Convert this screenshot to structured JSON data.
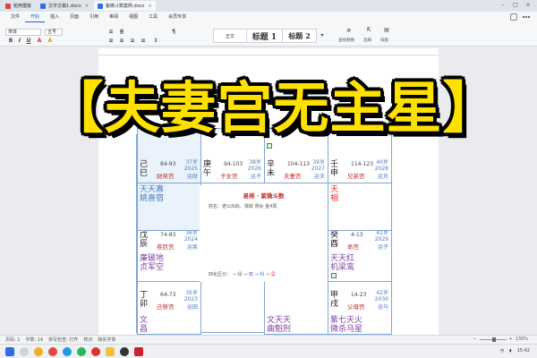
{
  "window": {
    "tabs": [
      {
        "label": "稻壳模板"
      },
      {
        "label": "文字文稿1.docx",
        "active": true
      },
      {
        "label": "紫微斗数案例.docx"
      }
    ]
  },
  "menu": {
    "items": [
      "文件",
      "开始",
      "插入",
      "页面",
      "引用",
      "审阅",
      "视图",
      "工具",
      "会员专享"
    ],
    "active_index": 1
  },
  "ribbon": {
    "font_name": "宋体",
    "font_size": "五号",
    "styles": [
      {
        "label": "正文"
      },
      {
        "label": "标题 1"
      },
      {
        "label": "标题 2"
      }
    ],
    "right_labels": [
      "查找替换",
      "选择",
      "排版"
    ]
  },
  "overlay": {
    "title": "【夫妻宫无主星】"
  },
  "chart": {
    "center": {
      "title": "易排 · 紫微斗数",
      "info": "姓名：老公出轨、嫖妓  阴女 金4局",
      "flow_label": "四化区分：",
      "flow_items": [
        "禄",
        "权",
        "科",
        "忌"
      ]
    },
    "palaces": [
      {
        "key": "si",
        "stars": "天天寡",
        "stars2": "姚喜宿",
        "gz": "己巳",
        "range": "84-93",
        "name": "财帛宫",
        "age": "37岁",
        "year": "2025",
        "luck": "运财"
      },
      {
        "key": "wu",
        "stars": "",
        "stars2": "",
        "gz": "庚午",
        "range": "94-103",
        "name": "子女宫",
        "age": "38岁",
        "year": "2026",
        "luck": "运子"
      },
      {
        "key": "wei",
        "stars": "",
        "stars2": "",
        "gz": "辛未",
        "range": "104-113",
        "name": "夫妻宫",
        "age": "39岁",
        "year": "2027",
        "luck": "运夫"
      },
      {
        "key": "shen",
        "stars": "天",
        "stars2": "相",
        "gz": "壬申",
        "range": "114-123",
        "name": "兄弟宫",
        "age": "40岁",
        "year": "2028",
        "luck": "运兄"
      },
      {
        "key": "chen",
        "stars": "廉破地",
        "stars2": "贞军空",
        "gz": "戊辰",
        "range": "74-83",
        "name": "疾厄宫",
        "age": "36岁",
        "year": "2024",
        "luck": "运疾"
      },
      {
        "key": "you",
        "stars": "天天红",
        "stars2": "机梁鸾",
        "gz": "癸酉",
        "range": "4-13",
        "name": "命宫",
        "age": "41岁",
        "year": "2029",
        "luck": "运子"
      },
      {
        "key": "mao",
        "stars": "文",
        "stars2": "昌",
        "gz": "丁卯",
        "range": "64-73",
        "name": "迁移宫",
        "age": "35岁",
        "year": "2023",
        "luck": "运田"
      },
      {
        "key": "xu",
        "stars": "紫七天火",
        "stars2": "微杀马星",
        "gz": "甲戌",
        "range": "14-23",
        "name": "父母宫",
        "age": "42岁",
        "year": "2030",
        "luck": "运马"
      },
      {
        "key": "chou",
        "stars": "文天天",
        "stars2": "曲魁刑",
        "gz": "",
        "range": "",
        "name": "",
        "age": "",
        "year": "",
        "luck": ""
      }
    ]
  },
  "statusbar": {
    "left": [
      "页码: 1",
      "字数: 14",
      "拼写检查: 打开",
      "校对",
      "缺失字体"
    ],
    "zoom": "130%"
  },
  "taskbar": {
    "time": "15:42"
  },
  "colors": {
    "overlay_fill": "#ffe100",
    "grid_border": "#7fa6d8",
    "palace_name": "#c02a2a",
    "star_blue": "#4b7cc4",
    "accent": "#1a5fd6"
  }
}
